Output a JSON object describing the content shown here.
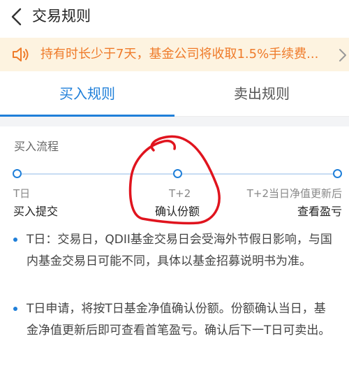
{
  "header": {
    "title": "交易规则"
  },
  "notice": {
    "text": "持有时长少于7天，基金公司将收取1.5%手续费..."
  },
  "tabs": [
    {
      "label": "买入规则"
    },
    {
      "label": "卖出规则"
    }
  ],
  "process": {
    "title": "买入流程",
    "steps": [
      {
        "day": "T日",
        "action": "买入提交"
      },
      {
        "day": "T+2",
        "action": "确认份额"
      },
      {
        "day": "T+2当日净值更新后",
        "action": "查看盈亏"
      }
    ]
  },
  "notes": [
    "T日：交易日，QDII基金交易日会受海外节假日影响，与国内基金交易日可能不同，具体以基金招募说明书为准。",
    "T日申请，将按T日基金净值确认份额。份额确认当日，基金净值更新后即可查看首笔盈亏。确认后下一T日可卖出。"
  ],
  "colors": {
    "accent": "#1f7fd9",
    "notice_text": "#ef7b2a",
    "notice_bg": "#fdf3e0",
    "annotation": "#e0141e"
  }
}
